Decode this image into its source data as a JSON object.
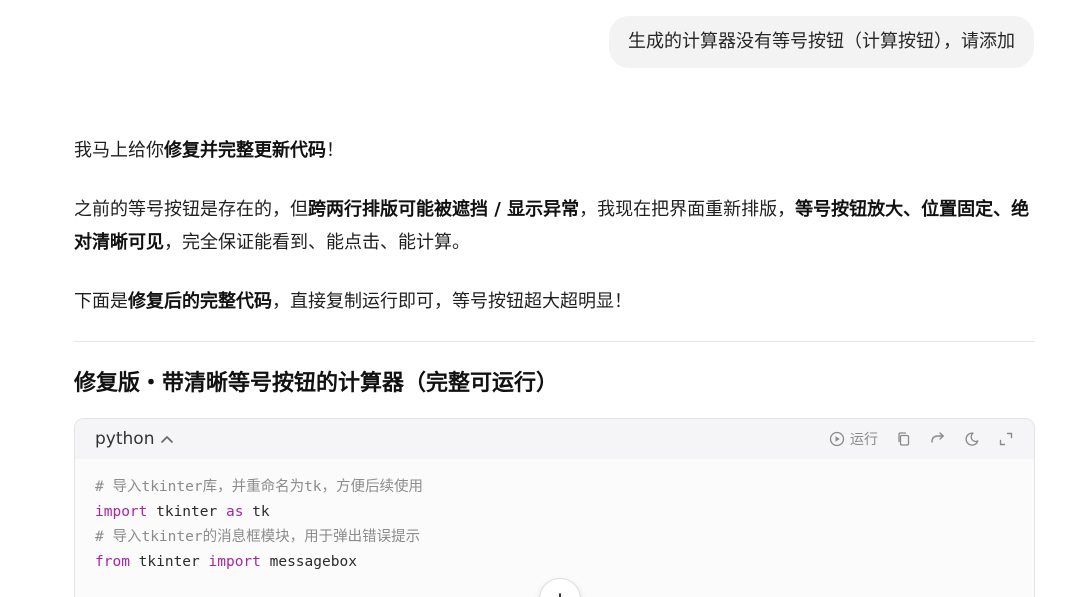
{
  "user_message": "生成的计算器没有等号按钮（计算按钮），请添加",
  "reply": {
    "p1": {
      "t1": "我马上给你",
      "b1": "修复并完整更新代码",
      "t2": "！"
    },
    "p2": {
      "t1": "之前的等号按钮是存在的，但",
      "b1": "跨两行排版可能被遮挡 / 显示异常",
      "t2": "，我现在把界面重新排版，",
      "b2": "等号按钮放大、位置固定、绝对清晰可见",
      "t3": "，完全保证能看到、能点击、能计算。"
    },
    "p3": {
      "t1": "下面是",
      "b1": "修复后的完整代码",
      "t2": "，直接复制运行即可，等号按钮超大超明显！"
    },
    "heading": "修复版・带清晰等号按钮的计算器（完整可运行）"
  },
  "code_block": {
    "language": "python",
    "run_label": "运行",
    "lines": {
      "l1": "# 导入tkinter库，并重命名为tk，方便后续使用",
      "l2_kw": "import",
      "l2_a": " tkinter ",
      "l2_kw2": "as",
      "l2_b": " tk",
      "l3": "# 导入tkinter的消息框模块，用于弹出错误提示",
      "l4_kw": "from",
      "l4_a": " tkinter ",
      "l4_kw2": "import",
      "l4_b": " messagebox"
    }
  },
  "icons": {
    "run": "play-circle-icon",
    "copy": "copy-icon",
    "share": "share-arrow-icon",
    "theme": "moon-icon",
    "expand": "expand-icon",
    "scroll": "plus-icon"
  }
}
